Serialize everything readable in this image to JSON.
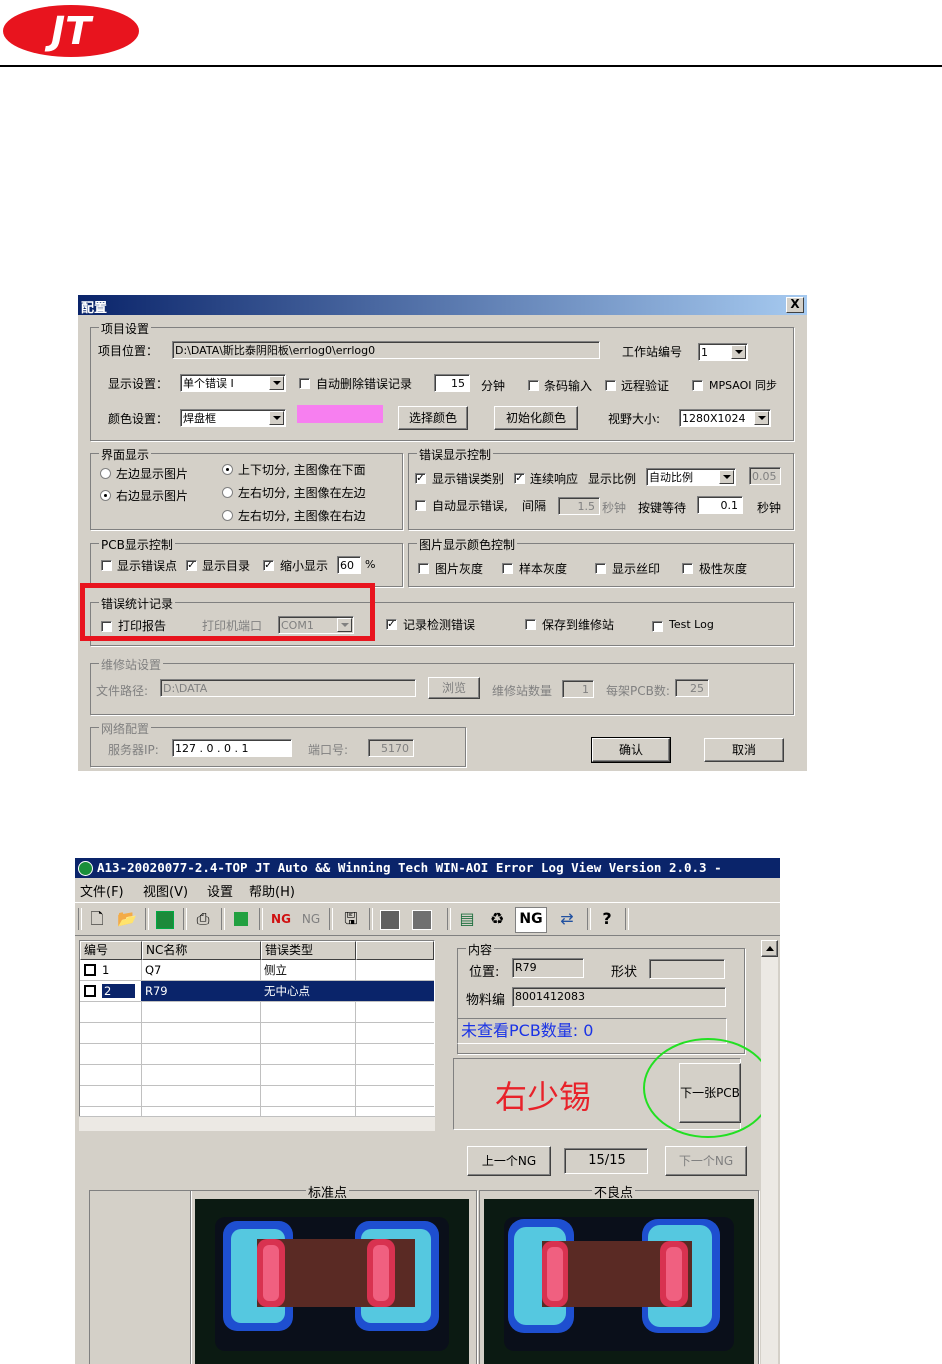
{
  "header": {
    "logo_text": "JT",
    "brand_color": "#e8141e"
  },
  "config_dialog": {
    "title": "配置",
    "close_label": "X",
    "project": {
      "group_label": "项目设置",
      "path_label": "项目位置：",
      "path_value": "D:\\DATA\\斯比泰阴阳板\\errlog0\\errlog0",
      "station_label": "工作站编号",
      "station_value": "1",
      "display_label": "显示设置：",
      "display_value": "单个错误 I",
      "auto_delete_label": "自动删除错误记录",
      "minutes_value": "15",
      "minutes_unit": "分钟",
      "barcode_label": "条码输入",
      "remote_label": "远程验证",
      "mpsaoi_label": "MPSAOI 同步",
      "color_label": "颜色设置：",
      "color_value": "焊盘框",
      "swatch_color": "#f77ff0",
      "choose_color_button": "选择颜色",
      "init_color_button": "初始化颜色",
      "view_size_label": "视野大小:",
      "view_size_value": "1280X1024"
    },
    "interface": {
      "group_label": "界面显示",
      "left_pic": "左边显示图片",
      "right_pic": "右边显示图片",
      "split_top": "上下切分, 主图像在下面",
      "split_left": "左右切分, 主图像在左边",
      "split_right": "左右切分, 主图像在右边"
    },
    "error_display": {
      "group_label": "错误显示控制",
      "show_type": "显示错误类别",
      "continuous": "连续响应",
      "ratio_label": "显示比例",
      "ratio_value": "自动比例",
      "ratio_number": "0.05",
      "auto_show": "自动显示错误,",
      "interval_label": "间隔",
      "interval_value": "1.5",
      "seconds": "秒钟",
      "key_wait_label": "按键等待",
      "key_wait_value": "0.1",
      "seconds2": "秒钟"
    },
    "pcb_display": {
      "group_label": "PCB显示控制",
      "show_error_points": "显示错误点",
      "show_directory": "显示目录",
      "shrink": "缩小显示",
      "shrink_value": "60",
      "percent": "%"
    },
    "pic_color": {
      "group_label": "图片显示颜色控制",
      "gray": "图片灰度",
      "sample_gray": "样本灰度",
      "silkscreen": "显示丝印",
      "polarity_gray": "极性灰度"
    },
    "error_stats": {
      "group_label": "错误统计记录",
      "print_report": "打印报告",
      "printer_port_label": "打印机端口",
      "printer_port_value": "COM1",
      "record_errors": "记录检测错误",
      "save_to_repair": "保存到维修站",
      "test_log": "Test Log"
    },
    "repair_station": {
      "group_label": "维修站设置",
      "path_label": "文件路径:",
      "path_value": "D:\\DATA",
      "browse": "浏览",
      "count_label": "维修站数量",
      "count_value": "1",
      "per_rack_label": "每架PCB数:",
      "per_rack_value": "25"
    },
    "network": {
      "group_label": "网络配置",
      "server_label": "服务器IP:",
      "server_value": "127 . 0 . 0 . 1",
      "port_label": "端口号:",
      "port_value": "5170"
    },
    "ok_button": "确认",
    "cancel_button": "取消",
    "highlight_color": "#e8141e"
  },
  "app_window": {
    "title": "A13-20020077-2.4-TOP JT Auto && Winning Tech WIN-AOI Error Log View Version 2.0.3 -",
    "menu": [
      "文件(F)",
      "视图(V)",
      "设置",
      "帮助(H)"
    ],
    "toolbar_icons": [
      "new-icon",
      "open-icon",
      "board-icon",
      "print-icon",
      "grid-icon",
      "ng-red-icon",
      "ng-gray-icon",
      "save-icon",
      "layout-icon",
      "panel-icon",
      "screen-icon",
      "recycle-icon",
      "ng-icon",
      "network-icon",
      "help-icon"
    ],
    "ng_label": "NG",
    "table": {
      "columns": [
        "编号",
        "NC名称",
        "错误类型",
        ""
      ],
      "rows": [
        {
          "id": "1",
          "name": "Q7",
          "type": "侧立",
          "selected": false
        },
        {
          "id": "2",
          "name": "R79",
          "type": "无中心点",
          "selected": true
        }
      ]
    },
    "info": {
      "group_label": "内容",
      "position_label": "位置:",
      "position_value": "R79",
      "shape_label": "形状",
      "shape_value": "",
      "part_label": "物料编",
      "part_value": "8001412083",
      "unviewed": "未查看PCB数量: 0"
    },
    "result_text": "右少锡",
    "next_pcb_button": "下一张PCB",
    "prev_ng_button": "上一个NG",
    "counter": "15/15",
    "next_ng_button": "下一个NG",
    "standard_label": "标准点",
    "defect_label": "不良点",
    "circle_color": "#22e022"
  }
}
